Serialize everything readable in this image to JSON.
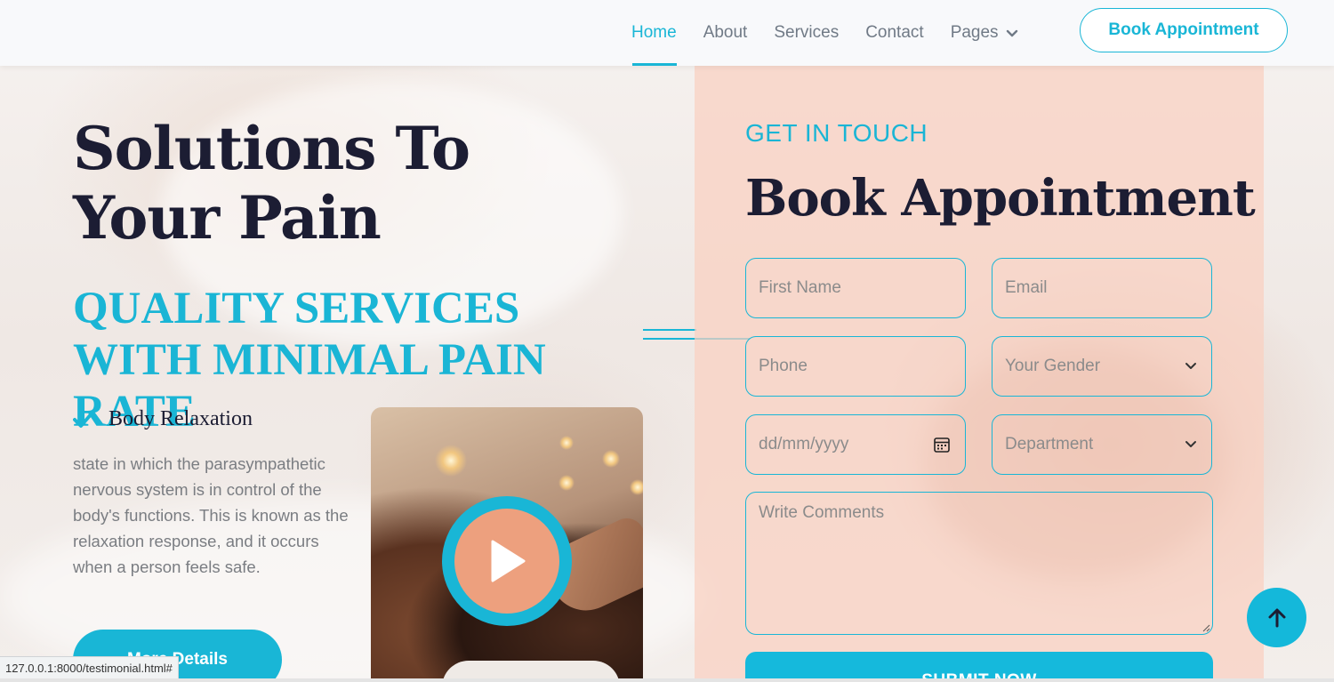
{
  "nav": {
    "items": [
      {
        "label": "Home",
        "active": true
      },
      {
        "label": "About",
        "active": false
      },
      {
        "label": "Services",
        "active": false
      },
      {
        "label": "Contact",
        "active": false
      },
      {
        "label": "Pages",
        "active": false
      }
    ],
    "cta_label": "Book Appointment"
  },
  "hero": {
    "title": "Solutions To Your Pain",
    "subtitle": "QUALITY SERVICES WITH MINIMAL PAIN RATE",
    "feature_label": "Body Relaxation",
    "description": "state in which the parasympathetic nervous system is in control of the body's functions. This is known as the relaxation response, and it occurs when a person feels safe.",
    "more_button": "More Details"
  },
  "form": {
    "eyebrow": "GET IN TOUCH",
    "title": "Book Appointment",
    "first_name_placeholder": "First Name",
    "email_placeholder": "Email",
    "phone_placeholder": "Phone",
    "gender_placeholder": "Your Gender",
    "date_placeholder": "dd/mm/yyyy",
    "department_placeholder": "Department",
    "comments_placeholder": "Write Comments",
    "submit_label": "SUBMIT NOW"
  },
  "status_bar": {
    "url": "127.0.0.1:8000/testimonial.html#"
  },
  "colors": {
    "accent": "#19b6d6",
    "heading": "#1c1d33",
    "panel": "#f9d0c0",
    "play": "#eda07e"
  },
  "icons": [
    "chevron-down-icon",
    "check-icon",
    "play-icon",
    "calendar-icon",
    "arrow-up-icon"
  ]
}
